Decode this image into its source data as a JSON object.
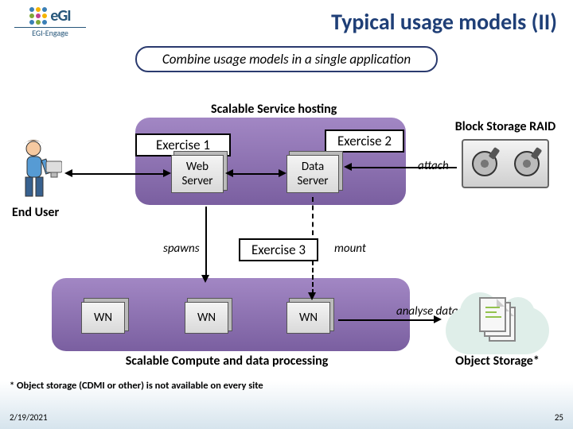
{
  "logo": {
    "main": "eGI",
    "sub": "EGI-Engage"
  },
  "title": "Typical usage models (II)",
  "banner": "Combine usage models in a single application",
  "labels": {
    "scalable_hosting": "Scalable Service hosting",
    "block_storage": "Block Storage RAID",
    "end_user": "End User",
    "scalable_compute": "Scalable Compute and data processing",
    "object_storage": "Object Storage*"
  },
  "exercises": {
    "ex1": "Exercise 1",
    "ex2": "Exercise 2",
    "ex3": "Exercise 3"
  },
  "nodes": {
    "web_server": "Web Server",
    "data_server": "Data Server",
    "wn": "WN"
  },
  "edge_labels": {
    "spawns": "spawns",
    "mount": "mount",
    "attach": "attach",
    "analyse": "analyse data"
  },
  "footnote": "* Object storage (CDMI or other) is not available on every site",
  "date": "2/19/2021",
  "page": "25"
}
